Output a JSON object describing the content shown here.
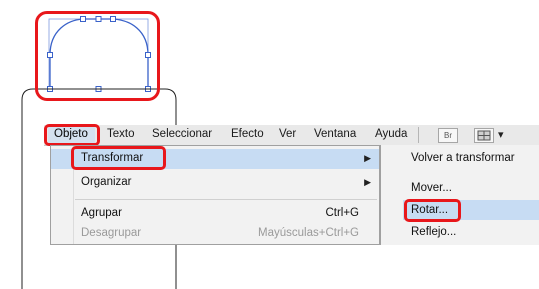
{
  "menubar": {
    "items": [
      "Objeto",
      "Texto",
      "Seleccionar",
      "Efecto",
      "Ver",
      "Ventana",
      "Ayuda"
    ],
    "bridge_button": "Br",
    "arrangement_arrow": "▾"
  },
  "object_menu": {
    "items": [
      {
        "label": "Transformar",
        "shortcut": "",
        "submenu": true,
        "enabled": true,
        "highlighted": true
      },
      {
        "label": "Organizar",
        "shortcut": "",
        "submenu": true,
        "enabled": true,
        "highlighted": false
      },
      {
        "label": "Agrupar",
        "shortcut": "Ctrl+G",
        "submenu": false,
        "enabled": true,
        "highlighted": false
      },
      {
        "label": "Desagrupar",
        "shortcut": "Mayúsculas+Ctrl+G",
        "submenu": false,
        "enabled": false,
        "highlighted": false
      }
    ]
  },
  "transform_submenu": {
    "items": [
      {
        "label": "Volver a transformar",
        "highlighted": false
      },
      {
        "label": "Mover...",
        "highlighted": false
      },
      {
        "label": "Rotar...",
        "highlighted": true
      },
      {
        "label": "Reflejo...",
        "highlighted": false
      }
    ]
  },
  "colors": {
    "highlight": "#e8171b",
    "path_stroke": "#3a62c9",
    "menu_background": "#f2f2f2",
    "selected_row": "#c7dcf3"
  }
}
